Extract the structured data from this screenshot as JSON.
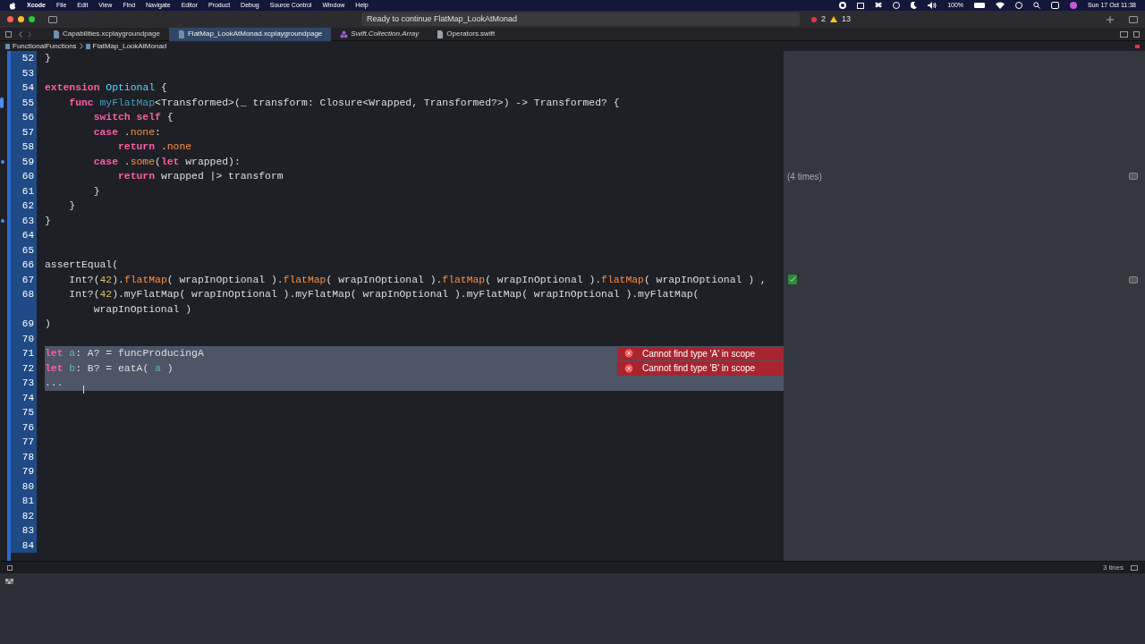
{
  "menu_bar": {
    "app": "Xcode",
    "menus": [
      "File",
      "Edit",
      "View",
      "Find",
      "Navigate",
      "Editor",
      "Product",
      "Debug",
      "Source Control",
      "Window",
      "Help"
    ],
    "battery": "100%",
    "clock": "Sun 17 Oct 11:38"
  },
  "toolbar": {
    "status": "Ready to continue FlatMap_LookAtMonad",
    "errors": "2",
    "warnings": "13"
  },
  "tabs": [
    {
      "label": "Capabilities.xcplaygroundpage",
      "selected": false,
      "kind": "playground"
    },
    {
      "label": "FlatMap_LookAtMonad.xcplaygroundpage",
      "selected": true,
      "kind": "playground"
    },
    {
      "label": "Swift.Collection.Array",
      "selected": false,
      "kind": "interface"
    },
    {
      "label": "Operators.swift",
      "selected": false,
      "kind": "swift"
    }
  ],
  "jump_bar": [
    "FunctionalFunctions",
    "FlatMap_LookAtMonad"
  ],
  "lines": [
    {
      "n": "52",
      "bar_marker": false,
      "dot_marker": false,
      "selected": false,
      "tokens": [
        {
          "kind": "plain",
          "t": "}"
        }
      ]
    },
    {
      "n": "53",
      "bar_marker": false,
      "dot_marker": false,
      "selected": false
    },
    {
      "n": "54",
      "bar_marker": false,
      "dot_marker": false,
      "selected": false,
      "tokens": [
        {
          "kind": "kw",
          "t": "extension"
        },
        {
          "kind": "type",
          "t": " Optional"
        },
        {
          "kind": "plain",
          "t": " {"
        }
      ]
    },
    {
      "n": "55",
      "bar_marker": true,
      "dot_marker": false,
      "selected": false,
      "tokens": [
        {
          "kind": "kw",
          "t": "    func"
        },
        {
          "kind": "decl",
          "t": " myFlatMap"
        },
        {
          "kind": "plain",
          "t": "<Transformed>(_ transform: Closure<Wrapped, Transformed?>) -> Transformed? {"
        }
      ]
    },
    {
      "n": "56",
      "bar_marker": false,
      "dot_marker": false,
      "selected": false,
      "tokens": [
        {
          "kind": "kw",
          "t": "        switch"
        },
        {
          "kind": "kw",
          "t": " self"
        },
        {
          "kind": "plain",
          "t": " {"
        }
      ]
    },
    {
      "n": "57",
      "bar_marker": false,
      "dot_marker": false,
      "selected": false,
      "tokens": [
        {
          "kind": "kw",
          "t": "        case"
        },
        {
          "kind": "plain",
          "t": " ."
        },
        {
          "kind": "member",
          "t": "none"
        },
        {
          "kind": "plain",
          "t": ":"
        }
      ]
    },
    {
      "n": "58",
      "bar_marker": false,
      "dot_marker": false,
      "selected": false,
      "tokens": [
        {
          "kind": "kw",
          "t": "            return"
        },
        {
          "kind": "plain",
          "t": " ."
        },
        {
          "kind": "member",
          "t": "none"
        }
      ]
    },
    {
      "n": "59",
      "bar_marker": false,
      "dot_marker": true,
      "selected": false,
      "tokens": [
        {
          "kind": "kw",
          "t": "        case"
        },
        {
          "kind": "plain",
          "t": " ."
        },
        {
          "kind": "member",
          "t": "some"
        },
        {
          "kind": "plain",
          "t": "("
        },
        {
          "kind": "kw",
          "t": "let"
        },
        {
          "kind": "plain",
          "t": " wrapped):"
        }
      ]
    },
    {
      "n": "60",
      "bar_marker": false,
      "dot_marker": false,
      "selected": false,
      "result": "(4 times)",
      "tokens": [
        {
          "kind": "kw",
          "t": "            return"
        },
        {
          "kind": "plain",
          "t": " wrapped |> transform"
        }
      ]
    },
    {
      "n": "61",
      "bar_marker": false,
      "dot_marker": false,
      "selected": false,
      "tokens": [
        {
          "kind": "plain",
          "t": "        }"
        }
      ]
    },
    {
      "n": "62",
      "bar_marker": false,
      "dot_marker": false,
      "selected": false,
      "tokens": [
        {
          "kind": "plain",
          "t": "    }"
        }
      ]
    },
    {
      "n": "63",
      "bar_marker": false,
      "dot_marker": true,
      "selected": false,
      "tokens": [
        {
          "kind": "plain",
          "t": "}"
        }
      ]
    },
    {
      "n": "64",
      "bar_marker": false,
      "dot_marker": false,
      "selected": false
    },
    {
      "n": "65",
      "bar_marker": false,
      "dot_marker": false,
      "selected": false
    },
    {
      "n": "66",
      "bar_marker": false,
      "dot_marker": false,
      "selected": false,
      "tokens": [
        {
          "kind": "plain",
          "t": "assertEqual("
        }
      ]
    },
    {
      "n": "67",
      "bar_marker": false,
      "dot_marker": false,
      "selected": false,
      "check": true,
      "tokens": [
        {
          "kind": "plain",
          "t": "    Int?("
        },
        {
          "kind": "number",
          "t": "42"
        },
        {
          "kind": "plain",
          "t": ")."
        },
        {
          "kind": "member",
          "t": "flatMap"
        },
        {
          "kind": "plain",
          "t": "( wrapInOptional )."
        },
        {
          "kind": "member",
          "t": "flatMap"
        },
        {
          "kind": "plain",
          "t": "( wrapInOptional )."
        },
        {
          "kind": "member",
          "t": "flatMap"
        },
        {
          "kind": "plain",
          "t": "( wrapInOptional )."
        },
        {
          "kind": "member",
          "t": "flatMap"
        },
        {
          "kind": "plain",
          "t": "( wrapInOptional ) ,"
        }
      ]
    },
    {
      "n": "68",
      "bar_marker": false,
      "dot_marker": false,
      "selected": false,
      "tokens": [
        {
          "kind": "plain",
          "t": "    Int?("
        },
        {
          "kind": "number",
          "t": "42"
        },
        {
          "kind": "plain",
          "t": ").myFlatMap( wrapInOptional ).myFlatMap( wrapInOptional ).myFlatMap( wrapInOptional ).myFlatMap("
        }
      ]
    },
    {
      "bar_marker": false,
      "dot_marker": false,
      "selected": false,
      "tokens": [
        {
          "kind": "plain",
          "t": "        wrapInOptional )"
        }
      ]
    },
    {
      "n": "69",
      "bar_marker": false,
      "dot_marker": false,
      "selected": false,
      "tokens": [
        {
          "kind": "plain",
          "t": ")"
        }
      ]
    },
    {
      "n": "70",
      "bar_marker": false,
      "dot_marker": false,
      "selected": false
    },
    {
      "n": "71",
      "bar_marker": false,
      "dot_marker": false,
      "selected": true,
      "error": "Cannot find type 'A' in scope",
      "tokens": [
        {
          "kind": "kw",
          "t": "let"
        },
        {
          "kind": "local",
          "t": " a"
        },
        {
          "kind": "plain",
          "t": ": A? = funcProducingA"
        }
      ]
    },
    {
      "n": "72",
      "bar_marker": false,
      "dot_marker": false,
      "selected": true,
      "error": "Cannot find type 'B' in scope",
      "tokens": [
        {
          "kind": "kw",
          "t": "let"
        },
        {
          "kind": "local",
          "t": " b"
        },
        {
          "kind": "plain",
          "t": ": B? = eatA( "
        },
        {
          "kind": "local",
          "t": "a"
        },
        {
          "kind": "plain",
          "t": " )"
        }
      ]
    },
    {
      "n": "73",
      "bar_marker": false,
      "dot_marker": false,
      "selected": true,
      "tokens": [
        {
          "kind": "plain",
          "t": "..."
        }
      ]
    },
    {
      "n": "74",
      "bar_marker": false,
      "dot_marker": false,
      "selected": false
    },
    {
      "n": "75",
      "bar_marker": false,
      "dot_marker": false,
      "selected": false
    },
    {
      "n": "76",
      "bar_marker": false,
      "dot_marker": false,
      "selected": false
    },
    {
      "n": "77",
      "bar_marker": false,
      "dot_marker": false,
      "selected": false
    },
    {
      "n": "78",
      "bar_marker": false,
      "dot_marker": false,
      "selected": false
    },
    {
      "n": "79",
      "bar_marker": false,
      "dot_marker": false,
      "selected": false
    },
    {
      "n": "80",
      "bar_marker": false,
      "dot_marker": false,
      "selected": false
    },
    {
      "n": "81",
      "bar_marker": false,
      "dot_marker": false,
      "selected": false
    },
    {
      "n": "82",
      "bar_marker": false,
      "dot_marker": false,
      "selected": false
    },
    {
      "n": "83",
      "bar_marker": false,
      "dot_marker": false,
      "selected": false
    },
    {
      "n": "84",
      "bar_marker": false,
      "dot_marker": false,
      "selected": false
    }
  ],
  "bottom_bar": {
    "line_count": "3 lines"
  }
}
